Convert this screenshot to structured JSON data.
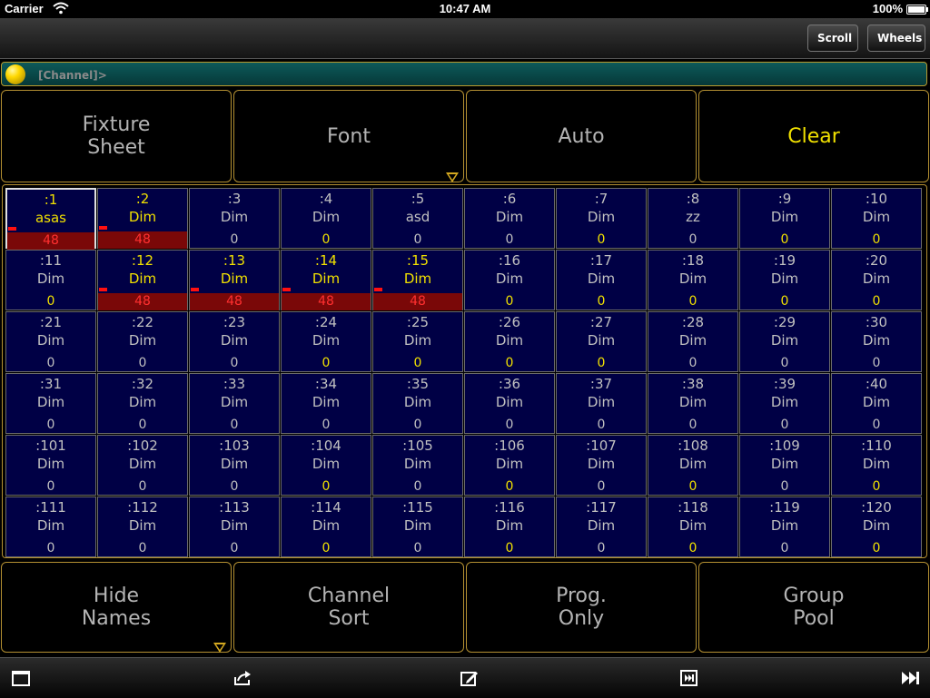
{
  "status_bar": {
    "carrier": "Carrier",
    "time": "10:47 AM",
    "battery": "100%"
  },
  "toolbar": {
    "scroll_label": "Scroll",
    "wheels_label": "Wheels"
  },
  "command_line": {
    "text": "[Channel]>"
  },
  "top_buttons": {
    "fixture_sheet": "Fixture\nSheet",
    "font": "Font",
    "auto": "Auto",
    "clear": "Clear"
  },
  "bottom_buttons": {
    "hide_names": "Hide\nNames",
    "channel_sort": "Channel\nSort",
    "prog_only": "Prog.\nOnly",
    "group_pool": "Group\nPool"
  },
  "colors": {
    "accent": "#f0e000",
    "cell_bg": "#000045",
    "border": "#b49032",
    "value_bar": "#7a0808"
  },
  "bottom_icons": [
    "window-icon",
    "share-icon",
    "edit-icon",
    "next-frame-icon",
    "fast-forward-icon"
  ],
  "channels": [
    {
      "num": ":1",
      "name": "asas",
      "value": "48",
      "state": "programmed",
      "selected": true
    },
    {
      "num": ":2",
      "name": "Dim",
      "value": "48",
      "state": "programmed"
    },
    {
      "num": ":3",
      "name": "Dim",
      "value": "0",
      "state": "normal"
    },
    {
      "num": ":4",
      "name": "Dim",
      "value": "0",
      "state": "yellow-value"
    },
    {
      "num": ":5",
      "name": "asd",
      "value": "0",
      "state": "normal"
    },
    {
      "num": ":6",
      "name": "Dim",
      "value": "0",
      "state": "normal"
    },
    {
      "num": ":7",
      "name": "Dim",
      "value": "0",
      "state": "yellow-value"
    },
    {
      "num": ":8",
      "name": "zz",
      "value": "0",
      "state": "normal"
    },
    {
      "num": ":9",
      "name": "Dim",
      "value": "0",
      "state": "yellow-value"
    },
    {
      "num": ":10",
      "name": "Dim",
      "value": "0",
      "state": "yellow-value"
    },
    {
      "num": ":11",
      "name": "Dim",
      "value": "0",
      "state": "yellow-value"
    },
    {
      "num": ":12",
      "name": "Dim",
      "value": "48",
      "state": "programmed"
    },
    {
      "num": ":13",
      "name": "Dim",
      "value": "48",
      "state": "programmed"
    },
    {
      "num": ":14",
      "name": "Dim",
      "value": "48",
      "state": "programmed"
    },
    {
      "num": ":15",
      "name": "Dim",
      "value": "48",
      "state": "programmed"
    },
    {
      "num": ":16",
      "name": "Dim",
      "value": "0",
      "state": "yellow-value"
    },
    {
      "num": ":17",
      "name": "Dim",
      "value": "0",
      "state": "yellow-value"
    },
    {
      "num": ":18",
      "name": "Dim",
      "value": "0",
      "state": "yellow-value"
    },
    {
      "num": ":19",
      "name": "Dim",
      "value": "0",
      "state": "yellow-value"
    },
    {
      "num": ":20",
      "name": "Dim",
      "value": "0",
      "state": "yellow-value"
    },
    {
      "num": ":21",
      "name": "Dim",
      "value": "0",
      "state": "normal"
    },
    {
      "num": ":22",
      "name": "Dim",
      "value": "0",
      "state": "normal"
    },
    {
      "num": ":23",
      "name": "Dim",
      "value": "0",
      "state": "normal"
    },
    {
      "num": ":24",
      "name": "Dim",
      "value": "0",
      "state": "yellow-value"
    },
    {
      "num": ":25",
      "name": "Dim",
      "value": "0",
      "state": "yellow-value"
    },
    {
      "num": ":26",
      "name": "Dim",
      "value": "0",
      "state": "yellow-value"
    },
    {
      "num": ":27",
      "name": "Dim",
      "value": "0",
      "state": "yellow-value"
    },
    {
      "num": ":28",
      "name": "Dim",
      "value": "0",
      "state": "normal"
    },
    {
      "num": ":29",
      "name": "Dim",
      "value": "0",
      "state": "normal"
    },
    {
      "num": ":30",
      "name": "Dim",
      "value": "0",
      "state": "normal"
    },
    {
      "num": ":31",
      "name": "Dim",
      "value": "0",
      "state": "normal"
    },
    {
      "num": ":32",
      "name": "Dim",
      "value": "0",
      "state": "normal"
    },
    {
      "num": ":33",
      "name": "Dim",
      "value": "0",
      "state": "normal"
    },
    {
      "num": ":34",
      "name": "Dim",
      "value": "0",
      "state": "normal"
    },
    {
      "num": ":35",
      "name": "Dim",
      "value": "0",
      "state": "normal"
    },
    {
      "num": ":36",
      "name": "Dim",
      "value": "0",
      "state": "normal"
    },
    {
      "num": ":37",
      "name": "Dim",
      "value": "0",
      "state": "normal"
    },
    {
      "num": ":38",
      "name": "Dim",
      "value": "0",
      "state": "normal"
    },
    {
      "num": ":39",
      "name": "Dim",
      "value": "0",
      "state": "normal"
    },
    {
      "num": ":40",
      "name": "Dim",
      "value": "0",
      "state": "normal"
    },
    {
      "num": ":101",
      "name": "Dim",
      "value": "0",
      "state": "normal"
    },
    {
      "num": ":102",
      "name": "Dim",
      "value": "0",
      "state": "normal"
    },
    {
      "num": ":103",
      "name": "Dim",
      "value": "0",
      "state": "normal"
    },
    {
      "num": ":104",
      "name": "Dim",
      "value": "0",
      "state": "yellow-value"
    },
    {
      "num": ":105",
      "name": "Dim",
      "value": "0",
      "state": "normal"
    },
    {
      "num": ":106",
      "name": "Dim",
      "value": "0",
      "state": "yellow-value"
    },
    {
      "num": ":107",
      "name": "Dim",
      "value": "0",
      "state": "normal"
    },
    {
      "num": ":108",
      "name": "Dim",
      "value": "0",
      "state": "yellow-value"
    },
    {
      "num": ":109",
      "name": "Dim",
      "value": "0",
      "state": "normal"
    },
    {
      "num": ":110",
      "name": "Dim",
      "value": "0",
      "state": "yellow-value"
    },
    {
      "num": ":111",
      "name": "Dim",
      "value": "0",
      "state": "normal"
    },
    {
      "num": ":112",
      "name": "Dim",
      "value": "0",
      "state": "normal"
    },
    {
      "num": ":113",
      "name": "Dim",
      "value": "0",
      "state": "normal"
    },
    {
      "num": ":114",
      "name": "Dim",
      "value": "0",
      "state": "yellow-value"
    },
    {
      "num": ":115",
      "name": "Dim",
      "value": "0",
      "state": "normal"
    },
    {
      "num": ":116",
      "name": "Dim",
      "value": "0",
      "state": "yellow-value"
    },
    {
      "num": ":117",
      "name": "Dim",
      "value": "0",
      "state": "normal"
    },
    {
      "num": ":118",
      "name": "Dim",
      "value": "0",
      "state": "yellow-value"
    },
    {
      "num": ":119",
      "name": "Dim",
      "value": "0",
      "state": "normal"
    },
    {
      "num": ":120",
      "name": "Dim",
      "value": "0",
      "state": "yellow-value"
    }
  ]
}
